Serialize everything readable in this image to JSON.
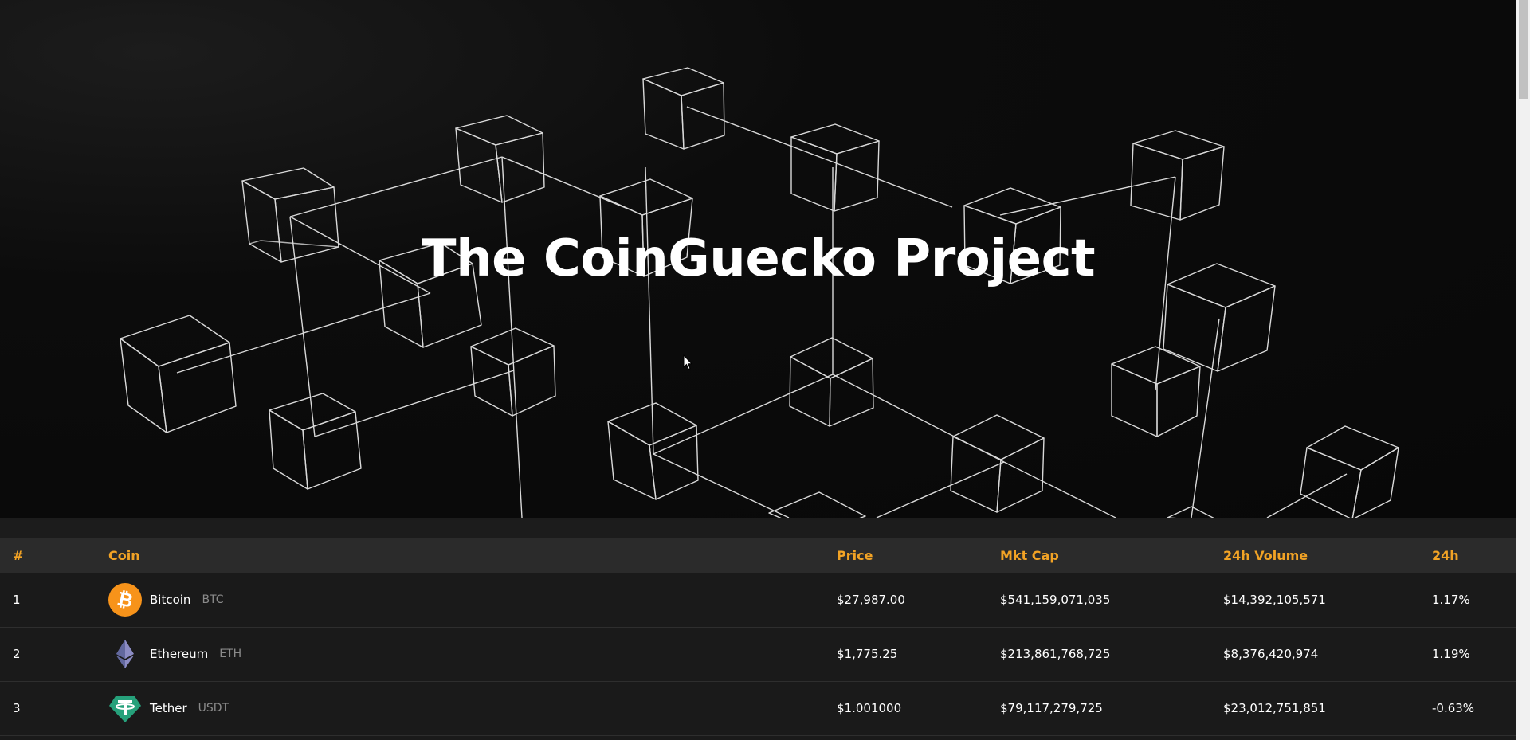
{
  "hero": {
    "title": "The CoinGuecko Project"
  },
  "table": {
    "headers": {
      "rank": "#",
      "coin": "Coin",
      "price": "Price",
      "mkt_cap": "Mkt Cap",
      "volume": "24h Volume",
      "change": "24h"
    },
    "rows": [
      {
        "rank": "1",
        "name": "Bitcoin",
        "symbol": "BTC",
        "icon": "bitcoin-icon",
        "price": "$27,987.00",
        "mkt_cap": "$541,159,071,035",
        "volume": "$14,392,105,571",
        "change": "1.17%",
        "change_direction": "up"
      },
      {
        "rank": "2",
        "name": "Ethereum",
        "symbol": "ETH",
        "icon": "ethereum-icon",
        "price": "$1,775.25",
        "mkt_cap": "$213,861,768,725",
        "volume": "$8,376,420,974",
        "change": "1.19%",
        "change_direction": "up"
      },
      {
        "rank": "3",
        "name": "Tether",
        "symbol": "USDT",
        "icon": "tether-icon",
        "price": "$1.001000",
        "mkt_cap": "$79,117,279,725",
        "volume": "$23,012,751,851",
        "change": "-0.63%",
        "change_direction": "down"
      }
    ]
  },
  "colors": {
    "accent": "#f2a325",
    "positive": "#2ecc40",
    "negative": "#ff2d2d",
    "hero_background": "#0a0a0a",
    "table_header_background": "#2b2b2b",
    "table_background": "#1a1a1a"
  }
}
